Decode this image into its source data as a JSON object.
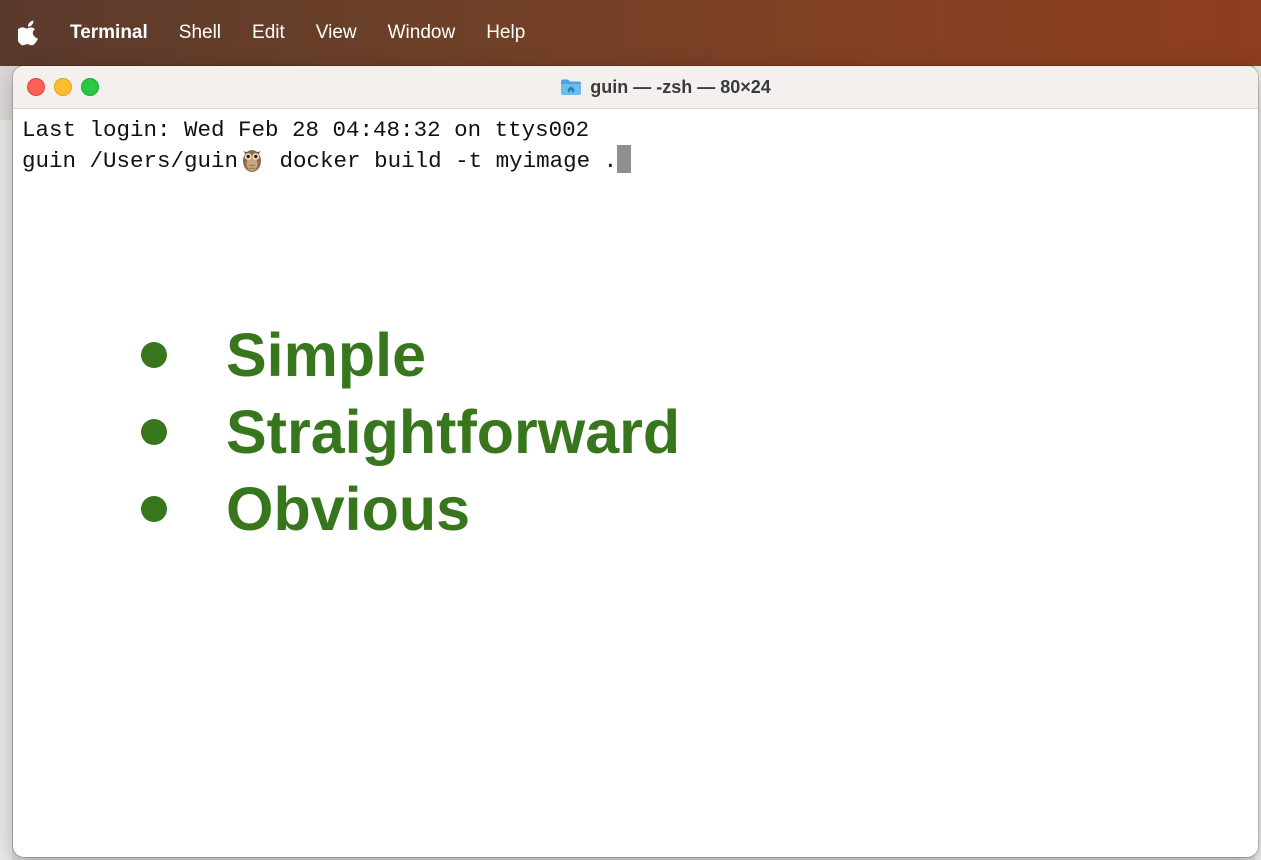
{
  "menubar": {
    "apple_icon": "apple-logo-icon",
    "app_name": "Terminal",
    "items": [
      "Shell",
      "Edit",
      "View",
      "Window",
      "Help"
    ]
  },
  "window": {
    "title": "guin — -zsh — 80×24",
    "title_icon": "home-folder-icon",
    "traffic_lights": {
      "close": "#fe5f57",
      "minimize": "#febc2e",
      "zoom": "#28c840"
    }
  },
  "terminal": {
    "line1": "Last login: Wed Feb 28 04:48:32 on ttys002",
    "prompt": "guin /Users/guin",
    "prompt_icon": "owl-icon",
    "command": " docker build -t myimage ."
  },
  "overlay": {
    "color": "#38761d",
    "bullets": [
      "Simple",
      "Straightforward",
      "Obvious"
    ]
  }
}
